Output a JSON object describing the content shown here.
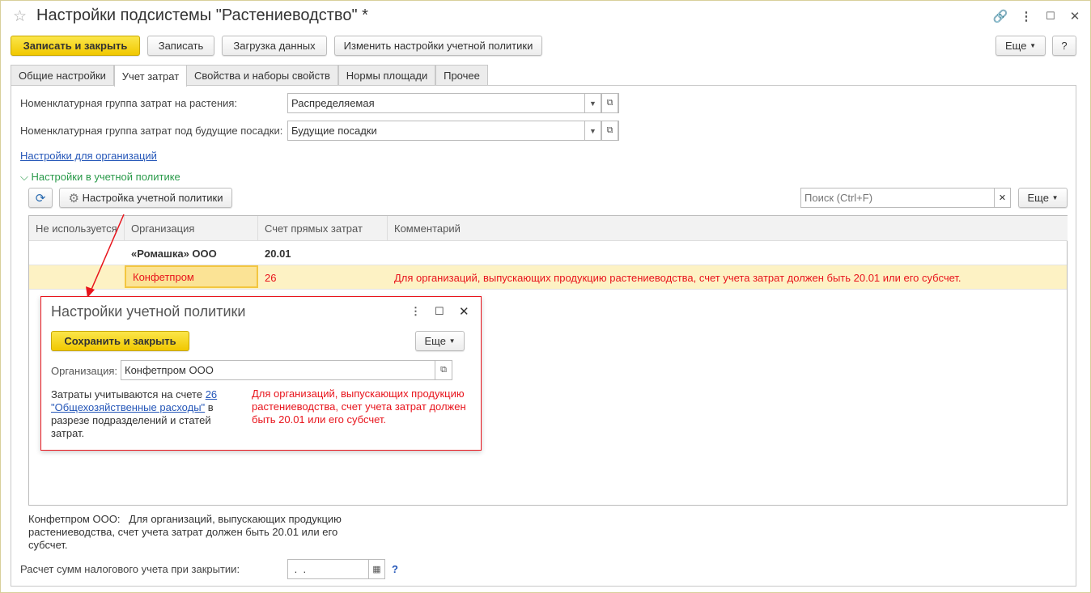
{
  "window": {
    "title": "Настройки подсистемы \"Растениеводство\" *"
  },
  "toolbar": {
    "save_close": "Записать и закрыть",
    "save": "Записать",
    "load": "Загрузка данных",
    "change_policy": "Изменить настройки учетной политики",
    "more": "Еще",
    "help": "?"
  },
  "tabs": [
    {
      "label": "Общие настройки"
    },
    {
      "label": "Учет затрат"
    },
    {
      "label": "Свойства и наборы свойств"
    },
    {
      "label": "Нормы площади"
    },
    {
      "label": "Прочее"
    }
  ],
  "form": {
    "plant_group_label": "Номенклатурная группа затрат на растения:",
    "plant_group_value": "Распределяемая",
    "future_group_label": "Номенклатурная группа затрат под будущие посадки:",
    "future_group_value": "Будущие посадки",
    "org_settings_link": "Настройки для организаций",
    "policy_group": "Настройки в учетной политике",
    "policy_btn": "Настройка учетной политики",
    "search_placeholder": "Поиск (Ctrl+F)",
    "more": "Еще",
    "tax_label": "Расчет сумм налогового учета при закрытии:",
    "tax_value": " .  .",
    "help": "?"
  },
  "table": {
    "columns": [
      "Не используется",
      "Организация",
      "Счет прямых затрат",
      "Комментарий"
    ],
    "rows": [
      {
        "unused": "",
        "org": "«Ромашка» ООО",
        "account": "20.01",
        "comment": ""
      },
      {
        "unused": "",
        "org": "Конфетпром",
        "account": "26",
        "comment": "Для организаций, выпускающих продукцию растениеводства, счет учета затрат должен быть 20.01 или его субсчет."
      }
    ]
  },
  "bottom_note": {
    "org": "Конфетпром ООО:",
    "text": "Для организаций, выпускающих продукцию растениеводства, счет учета затрат должен быть 20.01 или его субсчет."
  },
  "popup": {
    "title": "Настройки учетной политики",
    "save_close": "Сохранить и закрыть",
    "more": "Еще",
    "org_label": "Организация:",
    "org_value": "Конфетпром ООО",
    "info_pre": "Затраты учитываются на счете ",
    "info_link": "26 \"Общехозяйственные расходы\"",
    "info_post": " в разрезе подразделений и статей затрат.",
    "warning": "Для организаций, выпускающих продукцию растениеводства, счет учета затрат должен быть 20.01 или его субсчет."
  },
  "colors": {
    "accent": "#f1c800",
    "error": "#e8141c",
    "link": "#2456b8",
    "group": "#2a9a4a",
    "highlight": "#fdf2c4"
  }
}
